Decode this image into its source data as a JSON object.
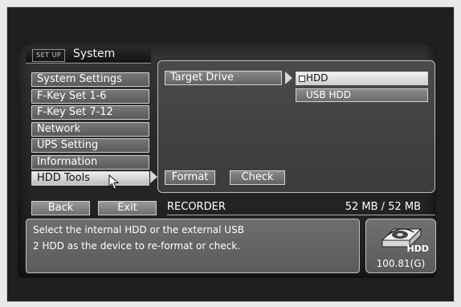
{
  "header": {
    "tag": "SET UP",
    "title": "System"
  },
  "menu": {
    "items": [
      {
        "label": "System Settings"
      },
      {
        "label": "F-Key Set 1-6"
      },
      {
        "label": "F-Key Set 7-12"
      },
      {
        "label": "Network"
      },
      {
        "label": "UPS Setting"
      },
      {
        "label": "Information"
      },
      {
        "label": "HDD Tools"
      }
    ],
    "active": "HDD Tools"
  },
  "panel": {
    "target_label": "Target Drive",
    "options": [
      {
        "label": "HDD",
        "selected": true
      },
      {
        "label": "USB HDD",
        "selected": false
      }
    ],
    "format_button": "Format",
    "check_button": "Check"
  },
  "bottom_bar": {
    "back": "Back",
    "exit": "Exit",
    "mode": "RECORDER",
    "capacity": "52 MB /  52 MB"
  },
  "info": {
    "message": "Select the internal HDD or the external USB\n2 HDD as the device to re-format or check."
  },
  "hdd_status": {
    "label": "HDD",
    "capacity": "100.81(G)"
  },
  "icons": [
    "cursor-arrow-icon",
    "right-arrow-icon",
    "hdd-icon",
    "checkbox-icon"
  ]
}
